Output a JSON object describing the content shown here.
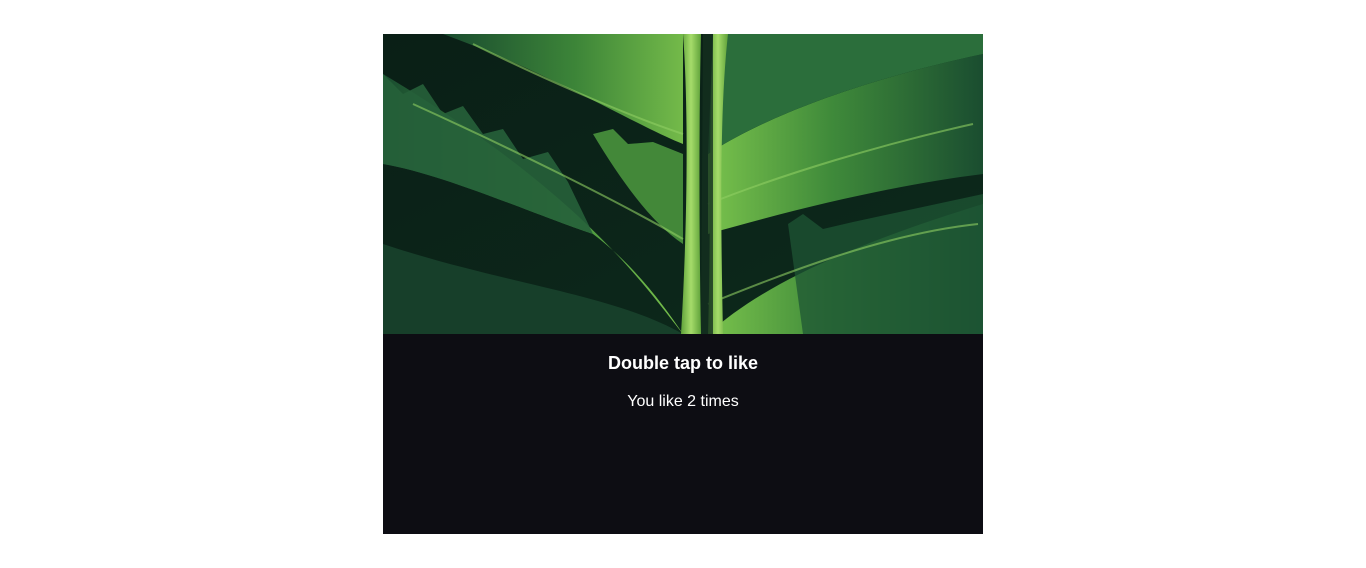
{
  "card": {
    "image_subject": "green-fern-leaf",
    "heading": "Double tap to like",
    "like_text": "You like 2 times",
    "like_count": 2
  },
  "colors": {
    "page_background": "#ffffff",
    "card_background": "#0d0d13",
    "text": "#ffffff",
    "leaf_light": "#7bc24f",
    "leaf_dark": "#1f5a34",
    "photo_background": "#0b2418"
  }
}
